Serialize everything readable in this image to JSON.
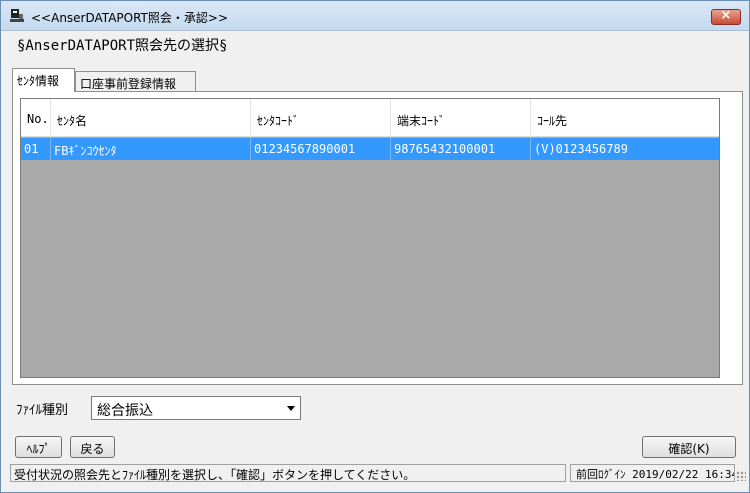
{
  "window": {
    "title": "<<AnserDATAPORT照会・承認>>",
    "close_label": "×"
  },
  "heading": "§AnserDATAPORT照会先の選択§",
  "tabs": [
    {
      "label": "ｾﾝﾀ情報",
      "active": true
    },
    {
      "label": "口座事前登録情報",
      "active": false
    }
  ],
  "grid": {
    "columns": [
      "No.",
      "ｾﾝﾀ名",
      "ｾﾝﾀｺｰﾄﾞ",
      "端末ｺｰﾄﾞ",
      "ｺｰﾙ先"
    ],
    "rows": [
      {
        "no": "01",
        "center_name": "FBｷﾞﾝｺｳｾﾝﾀ",
        "center_code": "01234567890001",
        "terminal_code": "98765432100001",
        "call_to": "(V)0123456789",
        "selected": true
      }
    ]
  },
  "file_type": {
    "label": "ﾌｧｲﾙ種別",
    "value": "総合振込"
  },
  "buttons": {
    "help": "ﾍﾙﾌﾟ",
    "back": "戻る",
    "confirm": "確認(K)"
  },
  "status": {
    "message": "受付状況の照会先とﾌｧｲﾙ種別を選択し、「確認」ボタンを押してください。",
    "last_login": "前回ﾛｸﾞｲﾝ 2019/02/22 16:34"
  },
  "colors": {
    "selection": "#3399ff",
    "grid_background": "#aaaaaa"
  }
}
